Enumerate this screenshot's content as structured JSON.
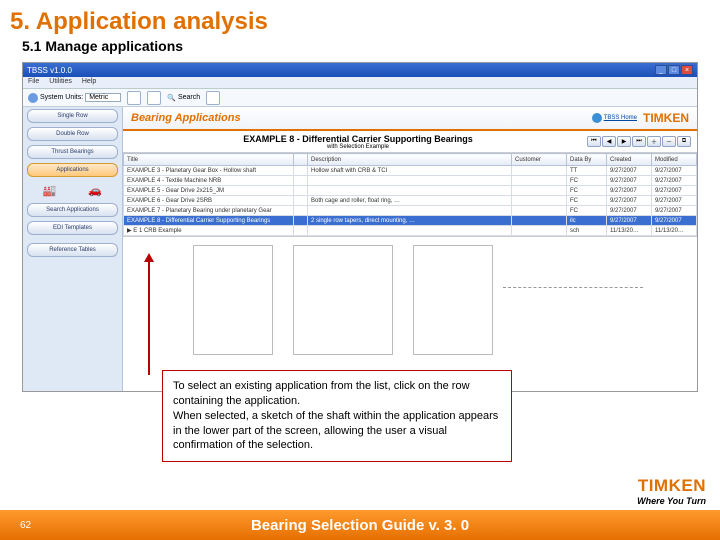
{
  "heading": "5. Application analysis",
  "sub": "5.1 Manage applications",
  "window": {
    "title": "TBSS v1.0.0",
    "menus": [
      "File",
      "Utilities",
      "Help"
    ]
  },
  "toolbar": {
    "sysunits_label": "System Units:",
    "sysunits_value": "Metric",
    "search": "Search"
  },
  "sidebar": {
    "items": [
      "Single Row",
      "Double Row",
      "Thrust Bearings",
      "Applications",
      "Search Applications",
      "EDI Templates",
      "Reference Tables"
    ]
  },
  "inner": {
    "title": "Bearing Applications",
    "homelink": "TBSS Home",
    "brand": "TIMKEN",
    "example_title": "EXAMPLE 8 - Differential Carrier Supporting Bearings",
    "example_sub": "with Selection Example"
  },
  "grid": {
    "cols": [
      "Title",
      "",
      "Description",
      "Customer",
      "Data By",
      "Created",
      "Modified"
    ],
    "rows": [
      {
        "t": "EXAMPLE 3 - Planetary Gear Box - Hollow shaft",
        "d": "Hollow shaft with CRB & TCI",
        "c": "",
        "by": "TT",
        "cr": "9/27/2007",
        "mo": "9/27/2007"
      },
      {
        "t": "EXAMPLE 4 - Textile Machine NRB",
        "d": "",
        "c": "",
        "by": "FC",
        "cr": "9/27/2007",
        "mo": "9/27/2007"
      },
      {
        "t": "EXAMPLE 5 - Gear Drive 2x215_JM",
        "d": "",
        "c": "",
        "by": "FC",
        "cr": "9/27/2007",
        "mo": "9/27/2007"
      },
      {
        "t": "EXAMPLE 6 - Gear Drive 2SRB",
        "d": "Both cage and roller, float ring, …",
        "c": "",
        "by": "FC",
        "cr": "9/27/2007",
        "mo": "9/27/2007"
      },
      {
        "t": "EXAMPLE 7 - Planetary Bearing under planetary Gear",
        "d": "",
        "c": "",
        "by": "FC",
        "cr": "9/27/2007",
        "mo": "9/27/2007"
      },
      {
        "t": "EXAMPLE 8 - Differential Carrier Supporting Bearings",
        "d": "2 single row tapers, direct mounting, …",
        "c": "",
        "by": "ilc",
        "cr": "9/27/2007",
        "mo": "9/27/2007",
        "sel": true
      },
      {
        "t": "▶ E 1 CRB Example",
        "d": "",
        "c": "",
        "by": "sch",
        "cr": "11/13/20…",
        "mo": "11/13/20…"
      }
    ]
  },
  "callout": "To select an existing application from the list, click on the row containing the application.\nWhen selected, a sketch of the shaft within the application appears in the lower part of the screen, allowing the user a visual confirmation of the selection.",
  "footer": {
    "page": "62",
    "title": "Bearing Selection Guide v. 3. 0"
  },
  "logo": {
    "name": "TIMKEN",
    "tag": "Where You Turn"
  }
}
